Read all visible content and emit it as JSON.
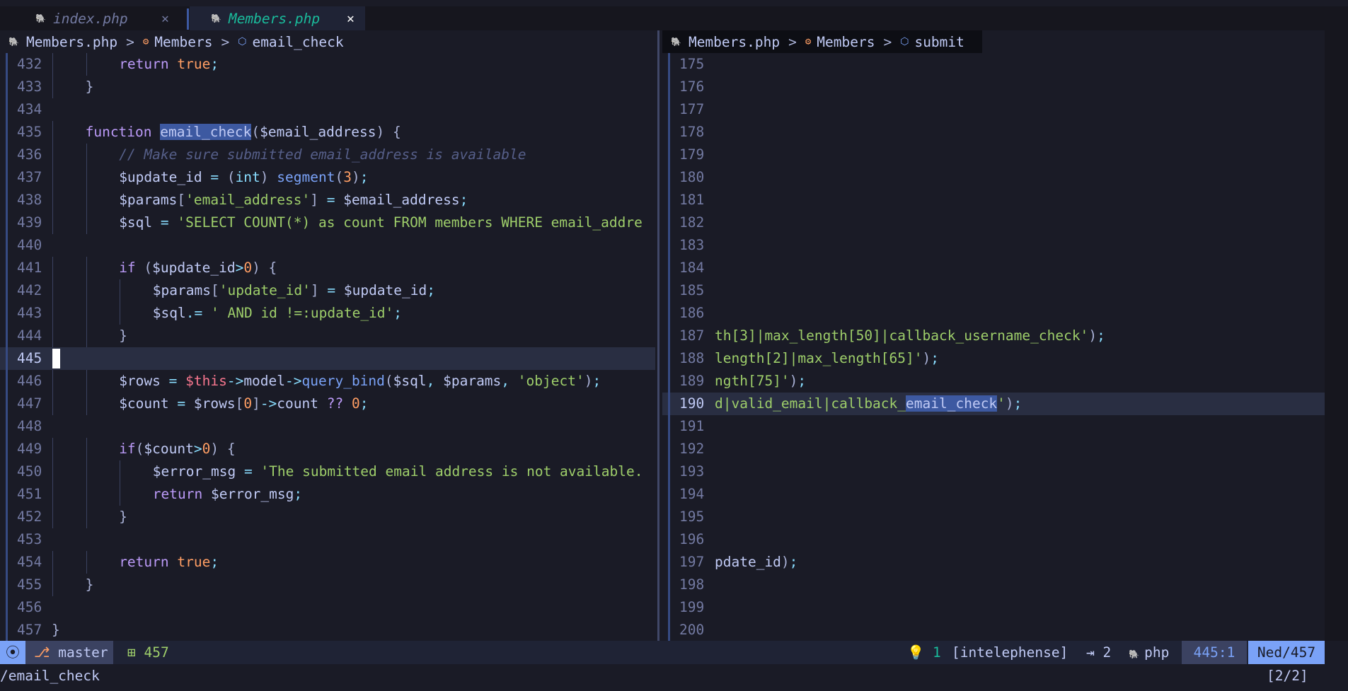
{
  "tabs": [
    {
      "label": "index.php",
      "icon": "php-elephant-icon",
      "close": "✕"
    },
    {
      "label": "Members.php",
      "icon": "php-elephant-icon",
      "close": "✕"
    }
  ],
  "left": {
    "breadcrumb": {
      "file": "Members.php",
      "sep": ">",
      "class": "Members",
      "method": "email_check"
    },
    "lines": [
      {
        "n": "432",
        "i": 2,
        "t": [
          [
            "k",
            "return "
          ],
          [
            "n",
            "true"
          ],
          [
            "o",
            ";"
          ]
        ]
      },
      {
        "n": "433",
        "i": 1,
        "t": [
          [
            "p",
            "}"
          ]
        ]
      },
      {
        "n": "434",
        "i": 0,
        "t": []
      },
      {
        "n": "435",
        "i": 1,
        "t": [
          [
            "k",
            "function "
          ],
          [
            "hl",
            "email_check"
          ],
          [
            "p",
            "("
          ],
          [
            "v",
            "$email_address"
          ],
          [
            "p",
            ") {"
          ]
        ]
      },
      {
        "n": "436",
        "i": 2,
        "t": [
          [
            "c",
            "// Make sure submitted email_address is available"
          ]
        ]
      },
      {
        "n": "437",
        "i": 2,
        "t": [
          [
            "v",
            "$update_id "
          ],
          [
            "o",
            "= "
          ],
          [
            "p",
            "("
          ],
          [
            "o",
            "int"
          ],
          [
            "p",
            ") "
          ],
          [
            "f",
            "segment"
          ],
          [
            "p",
            "("
          ],
          [
            "n",
            "3"
          ],
          [
            "p",
            ")"
          ],
          [
            "o",
            ";"
          ]
        ]
      },
      {
        "n": "438",
        "i": 2,
        "t": [
          [
            "v",
            "$params"
          ],
          [
            "p",
            "["
          ],
          [
            "s",
            "'email_address'"
          ],
          [
            "p",
            "] "
          ],
          [
            "o",
            "= "
          ],
          [
            "v",
            "$email_address"
          ],
          [
            "o",
            ";"
          ]
        ]
      },
      {
        "n": "439",
        "i": 2,
        "t": [
          [
            "v",
            "$sql "
          ],
          [
            "o",
            "= "
          ],
          [
            "s",
            "'SELECT COUNT(*) as count FROM members WHERE email_addre"
          ]
        ]
      },
      {
        "n": "440",
        "i": 0,
        "t": []
      },
      {
        "n": "441",
        "i": 2,
        "t": [
          [
            "k",
            "if "
          ],
          [
            "p",
            "("
          ],
          [
            "v",
            "$update_id"
          ],
          [
            "o",
            ">"
          ],
          [
            "n",
            "0"
          ],
          [
            "p",
            ") {"
          ]
        ]
      },
      {
        "n": "442",
        "i": 3,
        "t": [
          [
            "v",
            "$params"
          ],
          [
            "p",
            "["
          ],
          [
            "s",
            "'update_id'"
          ],
          [
            "p",
            "] "
          ],
          [
            "o",
            "= "
          ],
          [
            "v",
            "$update_id"
          ],
          [
            "o",
            ";"
          ]
        ]
      },
      {
        "n": "443",
        "i": 3,
        "t": [
          [
            "v",
            "$sql"
          ],
          [
            "o",
            ".= "
          ],
          [
            "s",
            "' AND id !=:update_id'"
          ],
          [
            "o",
            ";"
          ]
        ]
      },
      {
        "n": "444",
        "i": 2,
        "t": [
          [
            "p",
            "}"
          ]
        ]
      },
      {
        "n": "445",
        "i": 0,
        "t": [],
        "current": true
      },
      {
        "n": "446",
        "i": 2,
        "t": [
          [
            "v",
            "$rows "
          ],
          [
            "o",
            "= "
          ],
          [
            "t",
            "$this"
          ],
          [
            "o",
            "->"
          ],
          [
            "v",
            "model"
          ],
          [
            "o",
            "->"
          ],
          [
            "f",
            "query_bind"
          ],
          [
            "p",
            "("
          ],
          [
            "v",
            "$sql"
          ],
          [
            "o",
            ", "
          ],
          [
            "v",
            "$params"
          ],
          [
            "o",
            ", "
          ],
          [
            "s",
            "'object'"
          ],
          [
            "p",
            ")"
          ],
          [
            "o",
            ";"
          ]
        ]
      },
      {
        "n": "447",
        "i": 2,
        "t": [
          [
            "v",
            "$count "
          ],
          [
            "o",
            "= "
          ],
          [
            "v",
            "$rows"
          ],
          [
            "p",
            "["
          ],
          [
            "n",
            "0"
          ],
          [
            "p",
            "]"
          ],
          [
            "o",
            "->"
          ],
          [
            "v",
            "count "
          ],
          [
            "k",
            "?? "
          ],
          [
            "n",
            "0"
          ],
          [
            "o",
            ";"
          ]
        ]
      },
      {
        "n": "448",
        "i": 0,
        "t": []
      },
      {
        "n": "449",
        "i": 2,
        "t": [
          [
            "k",
            "if"
          ],
          [
            "p",
            "("
          ],
          [
            "v",
            "$count"
          ],
          [
            "o",
            ">"
          ],
          [
            "n",
            "0"
          ],
          [
            "p",
            ") {"
          ]
        ]
      },
      {
        "n": "450",
        "i": 3,
        "t": [
          [
            "v",
            "$error_msg "
          ],
          [
            "o",
            "= "
          ],
          [
            "s",
            "'The submitted email address is not available."
          ]
        ]
      },
      {
        "n": "451",
        "i": 3,
        "t": [
          [
            "k",
            "return "
          ],
          [
            "v",
            "$error_msg"
          ],
          [
            "o",
            ";"
          ]
        ]
      },
      {
        "n": "452",
        "i": 2,
        "t": [
          [
            "p",
            "}"
          ]
        ]
      },
      {
        "n": "453",
        "i": 0,
        "t": []
      },
      {
        "n": "454",
        "i": 2,
        "t": [
          [
            "k",
            "return "
          ],
          [
            "n",
            "true"
          ],
          [
            "o",
            ";"
          ]
        ]
      },
      {
        "n": "455",
        "i": 1,
        "t": [
          [
            "p",
            "}"
          ]
        ]
      },
      {
        "n": "456",
        "i": 0,
        "t": []
      },
      {
        "n": "457",
        "i": 0,
        "t": [
          [
            "p",
            "}"
          ]
        ]
      }
    ]
  },
  "right": {
    "breadcrumb": {
      "file": "Members.php",
      "sep": ">",
      "class": "Members",
      "method": "submit"
    },
    "lines": [
      {
        "n": "175",
        "t": []
      },
      {
        "n": "176",
        "t": []
      },
      {
        "n": "177",
        "t": []
      },
      {
        "n": "178",
        "t": []
      },
      {
        "n": "179",
        "t": []
      },
      {
        "n": "180",
        "t": []
      },
      {
        "n": "181",
        "t": []
      },
      {
        "n": "182",
        "t": []
      },
      {
        "n": "183",
        "t": []
      },
      {
        "n": "184",
        "t": []
      },
      {
        "n": "185",
        "t": []
      },
      {
        "n": "186",
        "t": []
      },
      {
        "n": "187",
        "t": [
          [
            "s",
            "th[3]|max_length[50]|callback_username_check'"
          ],
          [
            "p",
            ")"
          ],
          [
            "o",
            ";"
          ]
        ]
      },
      {
        "n": "188",
        "t": [
          [
            "s",
            "length[2]|max_length[65]'"
          ],
          [
            "p",
            ")"
          ],
          [
            "o",
            ";"
          ]
        ]
      },
      {
        "n": "189",
        "t": [
          [
            "s",
            "ngth[75]'"
          ],
          [
            "p",
            ")"
          ],
          [
            "o",
            ";"
          ]
        ]
      },
      {
        "n": "190",
        "t": [
          [
            "s",
            "d|valid_email|callback_"
          ],
          [
            "hls",
            "email_check"
          ],
          [
            "s",
            "'"
          ],
          [
            "p",
            ")"
          ],
          [
            "o",
            ";"
          ]
        ],
        "current": true
      },
      {
        "n": "191",
        "t": []
      },
      {
        "n": "192",
        "t": []
      },
      {
        "n": "193",
        "t": []
      },
      {
        "n": "194",
        "t": []
      },
      {
        "n": "195",
        "t": []
      },
      {
        "n": "196",
        "t": []
      },
      {
        "n": "197",
        "t": [
          [
            "v",
            "pdate_id"
          ],
          [
            "p",
            ")"
          ],
          [
            "o",
            ";"
          ]
        ]
      },
      {
        "n": "198",
        "t": []
      },
      {
        "n": "199",
        "t": []
      },
      {
        "n": "200",
        "t": []
      }
    ]
  },
  "statusline": {
    "mode_icon": "⦿",
    "branch_icon": "branch-icon",
    "branch": "master",
    "diff_added": "⊞ 457",
    "diagnostics": "1",
    "lsp": "[intelephense]",
    "indent": "⇥ 2",
    "filetype": "php",
    "position": "445:1",
    "progress": "Ned/457"
  },
  "cmdline": {
    "text": "/email_check",
    "count": "[2/2]"
  },
  "colors": {
    "accent": "#7aa2f7",
    "keyword": "#bb9af7",
    "string": "#9ece6a",
    "number": "#ff9e64",
    "comment": "#565f89",
    "operator": "#89ddff",
    "this": "#f7768e",
    "bg": "#1a1b26"
  }
}
